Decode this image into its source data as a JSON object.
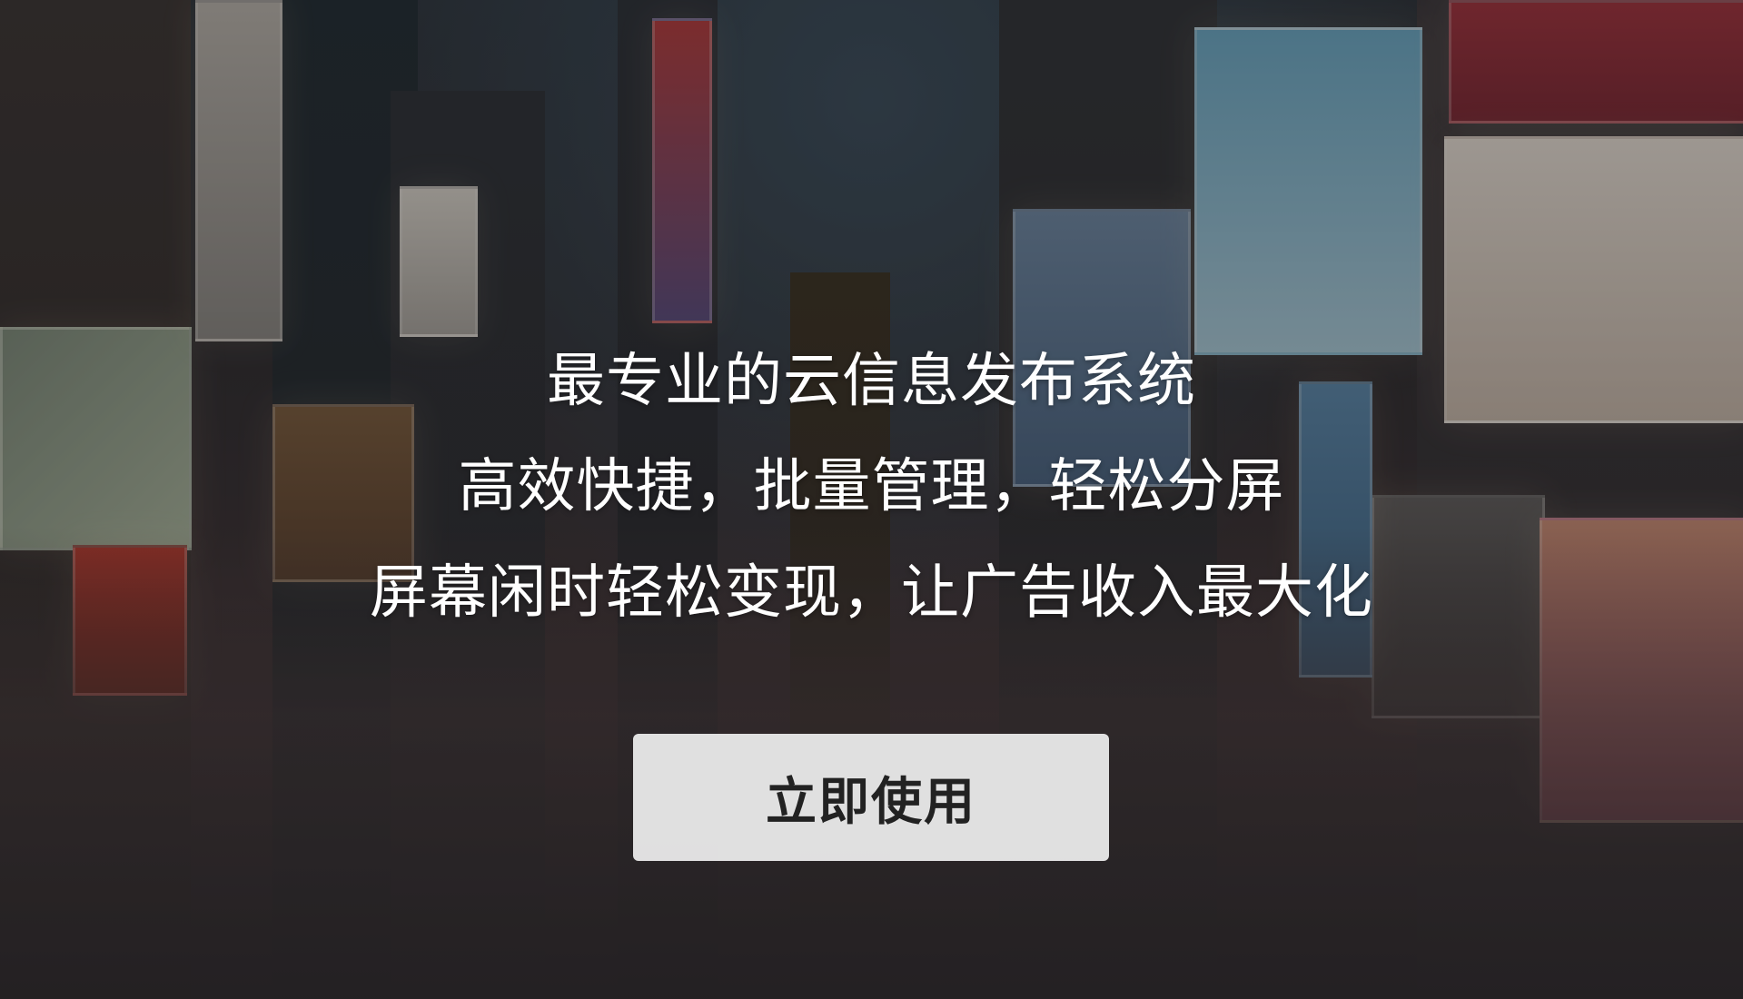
{
  "hero": {
    "headline_line1": "最专业的云信息发布系统",
    "headline_line2": "高效快捷，批量管理，轻松分屏",
    "headline_line3": "屏幕闲时轻松变现，让广告收入最大化",
    "cta_label": "立即使用"
  },
  "colors": {
    "headline_text": "#ffffff",
    "cta_background": "#f0f0f0",
    "cta_text": "#222222"
  }
}
